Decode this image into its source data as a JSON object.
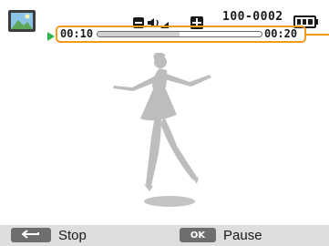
{
  "status": {
    "file_number": "100-0002"
  },
  "playback": {
    "elapsed": "00:10",
    "total": "00:20",
    "progress": 0.5
  },
  "controls": {
    "back_key": "",
    "back_label": "Stop",
    "ok_key": "OK",
    "ok_label": "Pause"
  },
  "colors": {
    "accent": "#f39a1e",
    "play": "#2fb54a",
    "bar": "#dedede"
  },
  "icons": [
    "video-thumbnail-icon",
    "play-icon",
    "volume-icon",
    "exposure-plus-icon",
    "battery-icon",
    "back-arrow-icon"
  ]
}
